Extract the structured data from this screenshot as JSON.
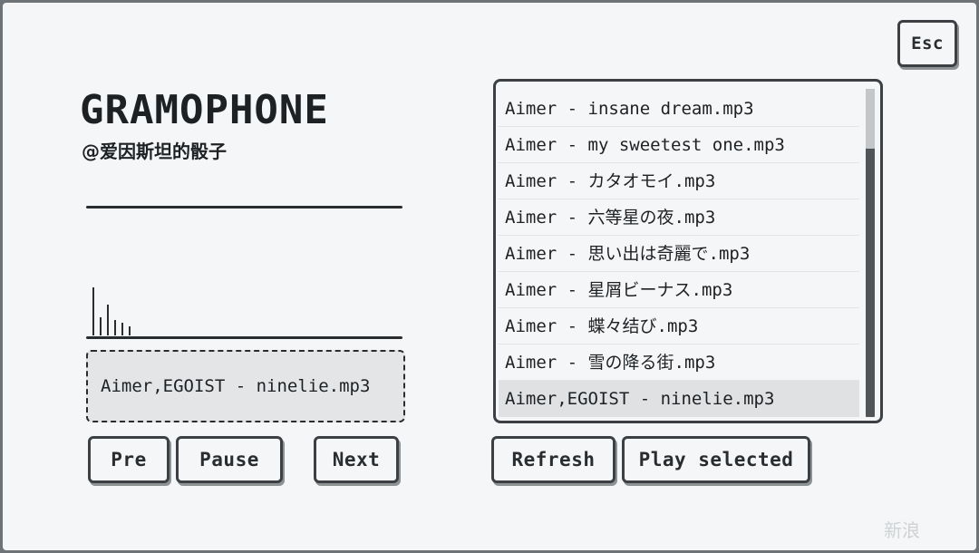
{
  "app": {
    "title": "GRAMOPHONE",
    "subtitle": "@爱因斯坦的骰子"
  },
  "toolbar": {
    "esc_label": "Esc"
  },
  "player": {
    "now_playing": "Aimer,EGOIST - ninelie.mp3",
    "controls": {
      "pre_label": "Pre",
      "pause_label": "Pause",
      "next_label": "Next"
    }
  },
  "playlist": {
    "items": [
      {
        "label": "Aimer - insane dream.mp3",
        "selected": false
      },
      {
        "label": "Aimer - my sweetest one.mp3",
        "selected": false
      },
      {
        "label": "Aimer - カタオモイ.mp3",
        "selected": false
      },
      {
        "label": "Aimer - 六等星の夜.mp3",
        "selected": false
      },
      {
        "label": "Aimer - 思い出は奇麗で.mp3",
        "selected": false
      },
      {
        "label": "Aimer - 星屑ビーナス.mp3",
        "selected": false
      },
      {
        "label": "Aimer - 蝶々结び.mp3",
        "selected": false
      },
      {
        "label": "Aimer - 雪の降る街.mp3",
        "selected": false
      },
      {
        "label": "Aimer,EGOIST - ninelie.mp3",
        "selected": true
      }
    ],
    "refresh_label": "Refresh",
    "play_selected_label": "Play selected"
  },
  "visualizer": {
    "levels": [
      0.95,
      0.35,
      0.6,
      0.3,
      0.25,
      0.18
    ]
  },
  "watermark": "新浪"
}
